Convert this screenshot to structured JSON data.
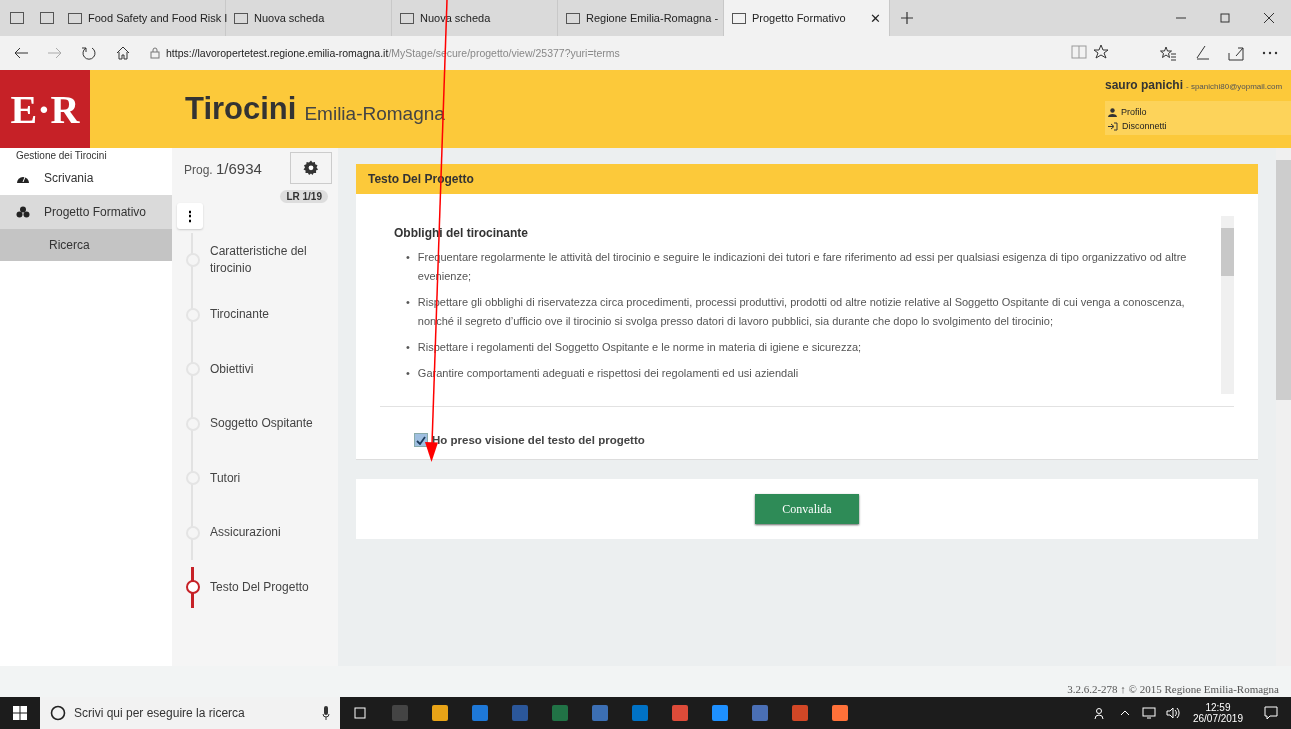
{
  "browser": {
    "tabs": [
      {
        "title": "Food Safety and Food Risk I",
        "selected": false
      },
      {
        "title": "Nuova scheda",
        "selected": false
      },
      {
        "title": "Nuova scheda",
        "selected": false
      },
      {
        "title": "Regione Emilia-Romagna -",
        "selected": false
      },
      {
        "title": "Progetto Formativo",
        "selected": true
      }
    ],
    "close_glyph": "✕",
    "url": {
      "host": "https://lavoropertetest.regione.emilia-romagna.it",
      "path": "/MyStage/secure/progetto/view/25377?yuri=terms"
    }
  },
  "header": {
    "logo": "E·R",
    "title": "Tirocini",
    "subtitle": "Emilia-Romagna",
    "user": {
      "name": "sauro panichi",
      "email": "- spanichi80@yopmail.com"
    },
    "menu": [
      "Profilo",
      "Disconnetti"
    ]
  },
  "sidebar": {
    "heading": "Gestione dei Tirocini",
    "items": [
      {
        "label": "Scrivania",
        "selected": false
      },
      {
        "label": "Progetto Formativo",
        "selected": true,
        "children": [
          {
            "label": "Ricerca",
            "selected": true
          }
        ]
      }
    ]
  },
  "steps": {
    "prog_label": "Prog.",
    "prog_value": "1/6934",
    "badge": "LR 1/19",
    "menu_glyph": "⋮",
    "items": [
      {
        "label": "Caratteristiche del tirocinio",
        "selected": false
      },
      {
        "label": "Tirocinante",
        "selected": false
      },
      {
        "label": "Obiettivi",
        "selected": false
      },
      {
        "label": "Soggetto Ospitante",
        "selected": false
      },
      {
        "label": "Tutori",
        "selected": false
      },
      {
        "label": "Assicurazioni",
        "selected": false
      },
      {
        "label": "Testo Del Progetto",
        "selected": true
      }
    ]
  },
  "panel": {
    "title": "Testo Del Progetto",
    "heading": "Obblighi del tirocinante",
    "bullet": "•",
    "bullets": [
      "Frequentare regolarmente le attività del tirocinio e seguire le indicazioni dei tutori e fare riferimento ad essi per qualsiasi esigenza di tipo organizzativo od altre evenienze;",
      "Rispettare gli obblighi di riservatezza circa procedimenti, processi produttivi, prodotti od altre notizie relative al Soggetto Ospitante di cui venga a conoscenza, nonché il segreto d’ufficio ove il tirocinio si svolga presso datori di lavoro pubblici, sia durante che dopo lo svolgimento del tirocinio;",
      "Rispettare i regolamenti del Soggetto Ospitante e le norme in materia di igiene e sicurezza;",
      "Garantire comportamenti adeguati e rispettosi dei regolamenti ed usi aziendali"
    ],
    "consent": {
      "label": "Ho preso visione del testo del progetto",
      "checked": true
    }
  },
  "submit": "Convalida",
  "footer": "3.2.6.2-278 ↑ © 2015 Regione Emilia-Romagna",
  "taskbar": {
    "search_placeholder": "Scrivi qui per eseguire la ricerca",
    "time": "12:59",
    "date": "26/07/2019"
  }
}
